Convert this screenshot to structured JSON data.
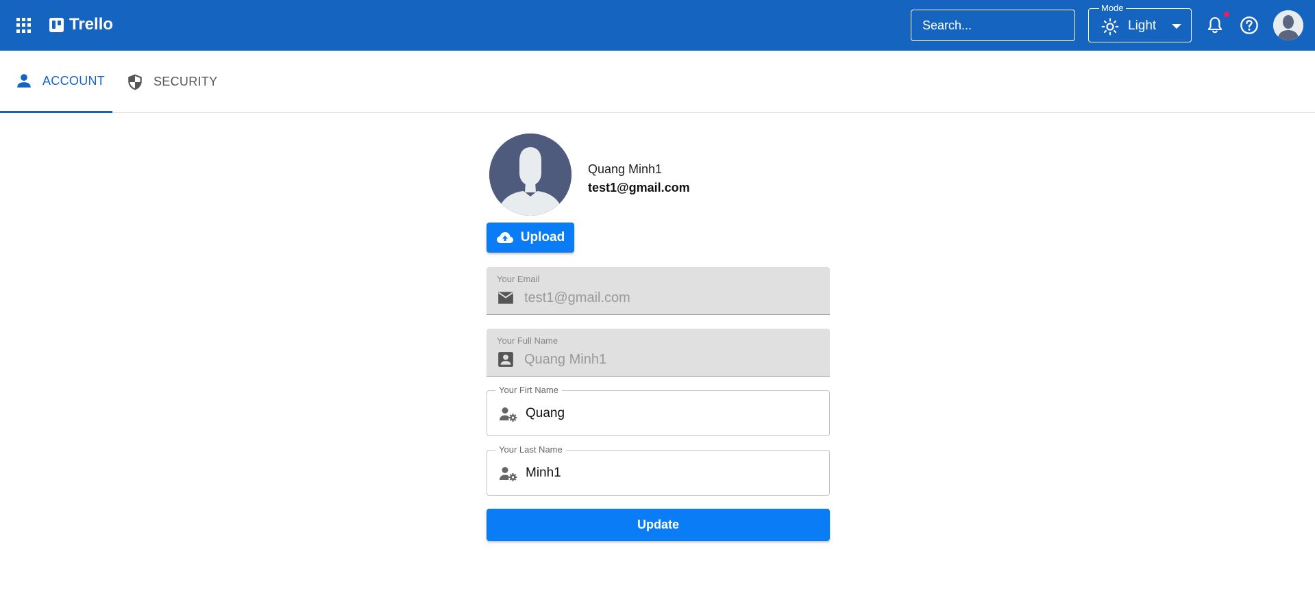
{
  "header": {
    "brand": "Trello",
    "search_placeholder": "Search...",
    "mode_label": "Mode",
    "mode_value": "Light",
    "background_color": "#1565c0",
    "notification_dot_color": "#e91e63"
  },
  "tabs": [
    {
      "label": "ACCOUNT",
      "icon": "person-icon",
      "active": true
    },
    {
      "label": "SECURITY",
      "icon": "shield-icon",
      "active": false
    }
  ],
  "profile": {
    "display_name": "Quang Minh1",
    "email": "test1@gmail.com"
  },
  "upload_button": {
    "label": "Upload",
    "icon": "cloud-upload-icon"
  },
  "form": {
    "email": {
      "label": "Your Email",
      "value": "test1@gmail.com",
      "icon": "mail-icon"
    },
    "full_name": {
      "label": "Your Full Name",
      "value": "Quang Minh1",
      "icon": "contact-icon"
    },
    "first_name": {
      "label": "Your Firt Name",
      "value": "Quang",
      "icon": "person-settings-icon"
    },
    "last_name": {
      "label": "Your Last Name",
      "value": "Minh1",
      "icon": "person-settings-icon"
    }
  },
  "update_button": {
    "label": "Update",
    "color": "#0a7cf5"
  }
}
